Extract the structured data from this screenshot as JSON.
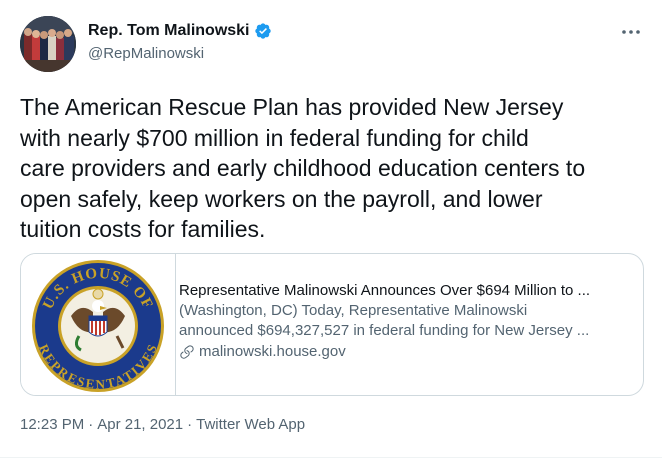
{
  "author": {
    "name": "Rep. Tom Malinowski",
    "handle": "@RepMalinowski",
    "verified_icon": "verified-badge-icon",
    "avatar_icon": "profile-photo"
  },
  "more_icon": "more-options-icon",
  "tweet": {
    "text": "The American Rescue Plan has provided New Jersey\nwith nearly $700 million in federal funding for child\ncare providers and early childhood education centers to\nopen safely, keep workers on the payroll, and lower\ntuition costs for families."
  },
  "link_card": {
    "seal_top_text": "U.S. HOUSE OF",
    "seal_bottom_text": "REPRESENTATIVES",
    "title": "Representative Malinowski Announces Over $694 Million to ...",
    "description_line1": "(Washington, DC) Today, Representative Malinowski",
    "description_line2": "announced $694,327,527 in federal funding for New Jersey ...",
    "domain": "malinowski.house.gov",
    "link_icon": "link-icon"
  },
  "meta": {
    "time": "12:23 PM",
    "date": "Apr 21, 2021",
    "source": "Twitter Web App",
    "separator": "·"
  },
  "colors": {
    "text": "#0f1419",
    "secondary": "#536471",
    "verified": "#1d9bf0",
    "border": "#cfd9de",
    "seal_blue": "#1b3a8c",
    "seal_gold": "#c9a227"
  }
}
